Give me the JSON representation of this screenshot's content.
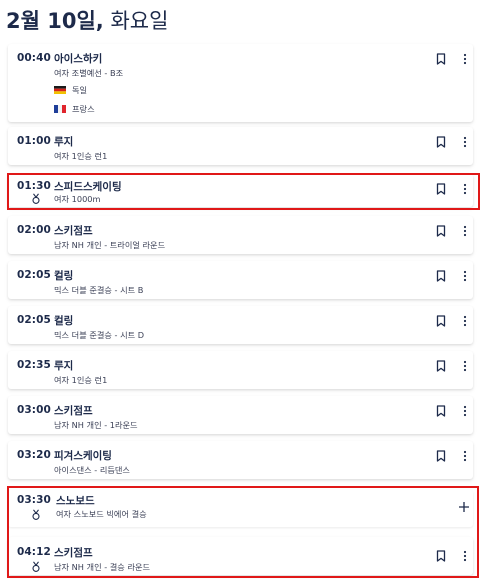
{
  "header": {
    "date_bold": "2월 10일,",
    "weekday": "화요일"
  },
  "colors": {
    "accent_highlight": "#e01818",
    "text_primary": "#1d2a4a",
    "card_shadow": "rgba(0,0,0,0.10)"
  },
  "events": [
    {
      "time": "00:40",
      "sport": "아이스하키",
      "event": "여자 조별예선 - B조",
      "medal": false,
      "action": "bookmark",
      "teams": [
        {
          "name": "독일",
          "flag": "germany-flag"
        },
        {
          "name": "프랑스",
          "flag": "france-flag"
        }
      ]
    },
    {
      "time": "01:00",
      "sport": "루지",
      "event": "여자 1인승 런1",
      "medal": false,
      "action": "bookmark"
    },
    {
      "time": "01:30",
      "sport": "스피드스케이팅",
      "event": "여자 1000m",
      "medal": true,
      "action": "bookmark",
      "highlighted": true
    },
    {
      "time": "02:00",
      "sport": "스키점프",
      "event": "남자 NH 개인 - 트라이얼 라운드",
      "medal": false,
      "action": "bookmark"
    },
    {
      "time": "02:05",
      "sport": "컬링",
      "event": "믹스 더블 준결승 - 시트 B",
      "medal": false,
      "action": "bookmark"
    },
    {
      "time": "02:05",
      "sport": "컬링",
      "event": "믹스 더블 준결승 - 시트 D",
      "medal": false,
      "action": "bookmark"
    },
    {
      "time": "02:35",
      "sport": "루지",
      "event": "여자 1인승 런1",
      "medal": false,
      "action": "bookmark"
    },
    {
      "time": "03:00",
      "sport": "스키점프",
      "event": "남자 NH 개인 - 1라운드",
      "medal": false,
      "action": "bookmark"
    },
    {
      "time": "03:20",
      "sport": "피겨스케이팅",
      "event": "아이스댄스 - 리듬댄스",
      "medal": false,
      "action": "bookmark"
    },
    {
      "time": "03:30",
      "sport": "스노보드",
      "event": "여자 스노보드 빅에어 결승",
      "medal": true,
      "action": "plus",
      "highlighted": true
    },
    {
      "time": "04:12",
      "sport": "스키점프",
      "event": "남자 NH 개인 - 결승 라운드",
      "medal": true,
      "action": "bookmark",
      "highlighted": true
    }
  ]
}
